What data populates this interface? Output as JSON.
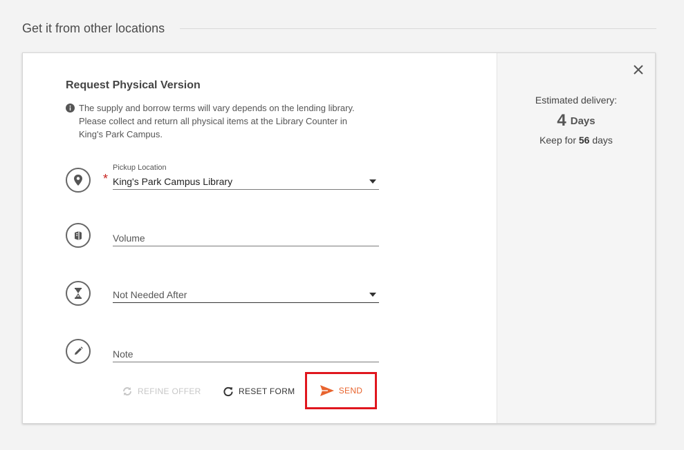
{
  "section": {
    "title": "Get it from other locations"
  },
  "form": {
    "title": "Request Physical Version",
    "notice": "The supply and borrow terms will vary depends on the lending library. Please collect and return all physical items at the Library Counter in King's Park Campus.",
    "required_mark": "*",
    "pickup": {
      "label": "Pickup Location",
      "value": "King's Park Campus Library"
    },
    "volume": {
      "placeholder": "Volume"
    },
    "not_needed_after": {
      "placeholder": "Not Needed After"
    },
    "note": {
      "placeholder": "Note"
    }
  },
  "actions": {
    "refine": "REFINE OFFER",
    "reset": "RESET FORM",
    "send": "SEND"
  },
  "side": {
    "estimated_label": "Estimated delivery:",
    "days_number": "4",
    "days_unit": "Days",
    "keep_prefix": "Keep for",
    "keep_days": "56",
    "keep_suffix": "days"
  },
  "colors": {
    "accent": "#e8642e",
    "highlight_border": "#e0161e",
    "required": "#c7221f"
  }
}
